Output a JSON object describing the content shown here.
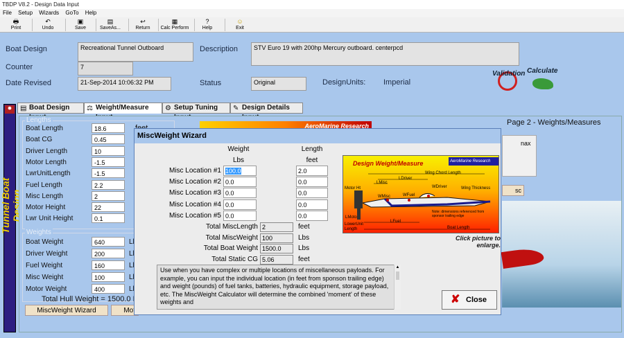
{
  "window": {
    "title": "TBDP V8.2 - Design Data Input"
  },
  "menu": [
    "File",
    "Setup",
    "Wizards",
    "GoTo",
    "Help"
  ],
  "toolbar": [
    {
      "label": "Print",
      "icon": "printer-icon"
    },
    {
      "label": "Undo",
      "icon": "undo-icon"
    },
    {
      "label": "Save",
      "icon": "save-icon"
    },
    {
      "label": "SaveAs...",
      "icon": "save-as-icon"
    },
    {
      "label": "Return",
      "icon": "return-icon"
    },
    {
      "label": "Calc Perform",
      "icon": "calculator-icon"
    },
    {
      "label": "Help",
      "icon": "help-icon"
    },
    {
      "label": "Exit",
      "icon": "exit-icon"
    }
  ],
  "header": {
    "boat_design_label": "Boat Design",
    "boat_design_value": "Recreational Tunnel Outboard",
    "description_label": "Description",
    "description_value": "STV Euro 19 with 200hp Mercury outboard. centerpcd",
    "counter_label": "Counter",
    "counter_value": "7",
    "date_revised_label": "Date Revised",
    "date_revised_value": "21-Sep-2014 10:06:32 PM",
    "status_label": "Status",
    "status_value": "Original",
    "design_units_label": "DesignUnits:",
    "design_units_value": "Imperial",
    "validation_label": "Validation",
    "calculate_label": "Calculate"
  },
  "tabs": [
    "Boat Design Input",
    "Weight/Measure Input",
    "Setup Tuning Input",
    "Design Details Input"
  ],
  "side_title": "Tunnel Boat Design",
  "page_label": "Page 2 - Weights/Measures",
  "lengths": {
    "legend": "Lengths",
    "unit_partial": "feet",
    "rows": [
      {
        "label": "Boat Length",
        "value": "18.6"
      },
      {
        "label": "Boat CG",
        "value": "0.45"
      },
      {
        "label": "Driver Length",
        "value": "10"
      },
      {
        "label": "Motor Length",
        "value": "-1.5"
      },
      {
        "label": "LwrUnitLength",
        "value": "-1.5"
      },
      {
        "label": "Fuel Length",
        "value": "2.2"
      },
      {
        "label": "Misc Length",
        "value": "2"
      },
      {
        "label": "Motor Height",
        "value": "22"
      },
      {
        "label": "Lwr Unit Height",
        "value": "0.1"
      }
    ]
  },
  "weights": {
    "legend": "Weights",
    "unit_partial": "Ll",
    "rows": [
      {
        "label": "Boat Weight",
        "value": "640"
      },
      {
        "label": "Driver Weight",
        "value": "200"
      },
      {
        "label": "Fuel Weight",
        "value": "160"
      },
      {
        "label": "Misc Weight",
        "value": "100"
      },
      {
        "label": "Motor Weight",
        "value": "400"
      }
    ],
    "total_hull": "Total Hull Weight = 1500.0 Lbs"
  },
  "buttons": {
    "misc_weight_wizard": "MiscWeight Wizard",
    "motor_partial": "Mot"
  },
  "right_panel": {
    "max_partial": "nax",
    "sc_partial": "sc"
  },
  "banner_text": "AeroMarine Research",
  "dialog": {
    "title": "MiscWeight Wizard",
    "weight_header": "Weight",
    "weight_unit": "Lbs",
    "length_header": "Length",
    "length_unit": "feet",
    "rows": [
      {
        "label": "Misc Location #1",
        "weight": "100.0",
        "length": "2.0"
      },
      {
        "label": "Misc Location #2",
        "weight": "0.0",
        "length": "0.0"
      },
      {
        "label": "Misc Location #3",
        "weight": "0.0",
        "length": "0.0"
      },
      {
        "label": "Misc Location #4",
        "weight": "0.0",
        "length": "0.0"
      },
      {
        "label": "Misc Location #5",
        "weight": "0.0",
        "length": "0.0"
      }
    ],
    "totals": [
      {
        "label": "Total MiscLength",
        "value": "2",
        "unit": "feet"
      },
      {
        "label": "Total MiscWeight",
        "value": "100",
        "unit": "Lbs"
      },
      {
        "label": "Total Boat Weight",
        "value": "1500.0",
        "unit": "Lbs"
      },
      {
        "label": "Total Static CG",
        "value": "5.06",
        "unit": "feet"
      }
    ],
    "diagram": {
      "title": "Design Weight/Measure",
      "brand": "AeroMarine Research",
      "labels": [
        "Wing Chord Length",
        "LDriver",
        "LMisc",
        "Motor Ht",
        "WDriver",
        "Wing Thickness",
        "WMisc",
        "WFuel",
        "LMotor",
        "LFuel",
        "LowerUnit Length",
        "Boat Length",
        "Note: dimensions referenced from sponsor trailing edge"
      ],
      "caption": "Click picture to enlarge."
    },
    "help_text": "Use when you have complex or multiple locations of miscellaneous payloads.  For example, you can input the individual location (in feet from sponson trailing edge) and weight (pounds) of fuel tanks, batteries, hydraulic equipment, storage payload, etc.  The MiscWeight Calculator will determine the combined 'moment' of these weights and",
    "close_label": "Close"
  }
}
